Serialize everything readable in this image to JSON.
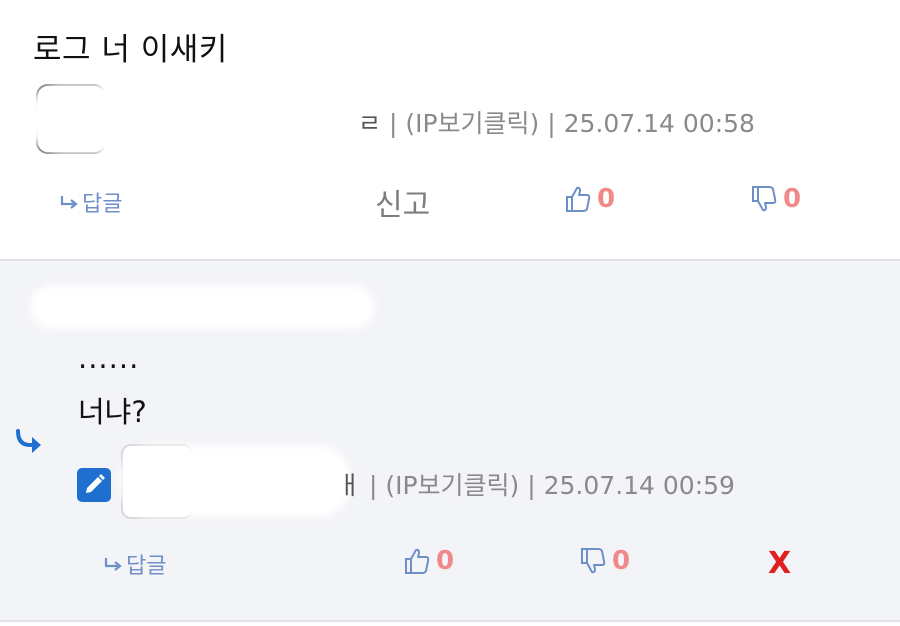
{
  "comment": {
    "text": "로그 너 이새키",
    "nickname_tail": "ㄹ",
    "ip_label": "| (IP보기클릭) | ",
    "timestamp": "25.07.14 00:58",
    "reply_label": "답글",
    "report_label": "신고",
    "upvotes": "0",
    "downvotes": "0"
  },
  "reply": {
    "line1": "......",
    "line2": "너냐?",
    "nickname_tail": "ㅐ",
    "ip_label": "| (IP보기클릭) | ",
    "timestamp": "25.07.14 00:59",
    "reply_label": "답글",
    "upvotes": "0",
    "downvotes": "0",
    "delete_label": "X"
  },
  "colors": {
    "accent": "#6f8fc8",
    "count": "#f08a8a",
    "delete": "#e02020",
    "reply_bg": "#f3f4f8",
    "edit_icon": "#1f6fd0"
  }
}
